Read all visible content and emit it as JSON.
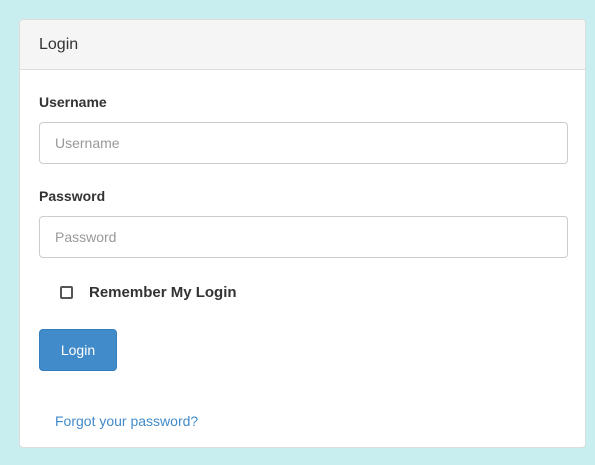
{
  "panel": {
    "heading": "Login"
  },
  "form": {
    "username_label": "Username",
    "username_placeholder": "Username",
    "username_value": "",
    "password_label": "Password",
    "password_placeholder": "Password",
    "password_value": "",
    "remember_label": "Remember My Login",
    "remember_checked": false,
    "login_button": "Login",
    "forgot_link": "Forgot your password?"
  },
  "colors": {
    "page_background": "#c9eef0",
    "primary": "#428bca",
    "panel_heading_background": "#f5f5f5"
  }
}
